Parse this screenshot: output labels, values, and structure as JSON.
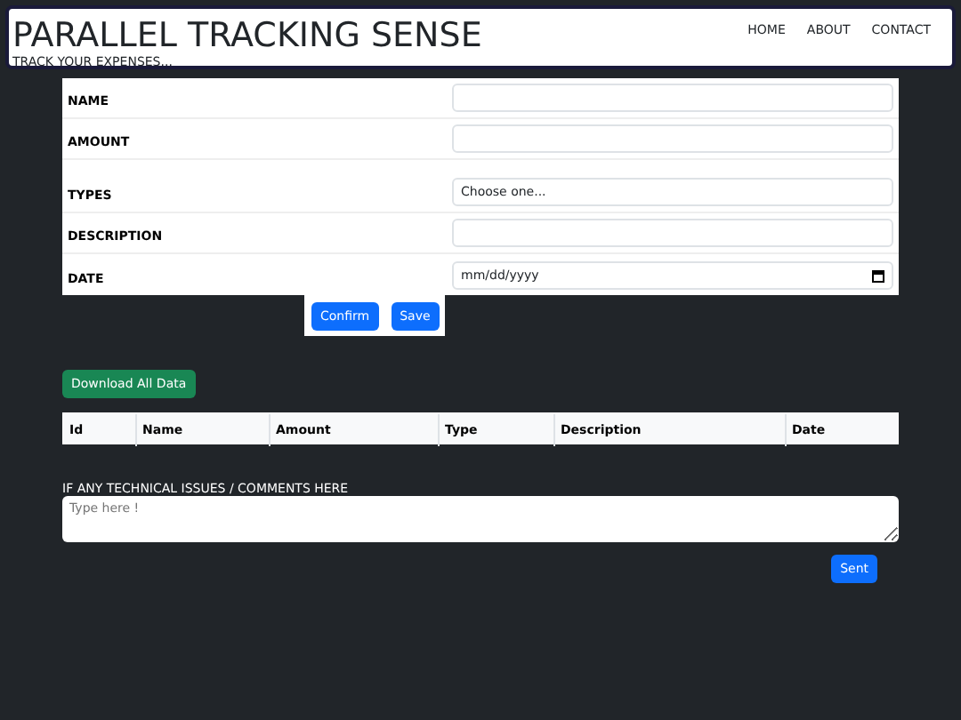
{
  "header": {
    "title": "PARALLEL TRACKING SENSE",
    "subtitle": "TRACK YOUR EXPENSES...",
    "nav": [
      "HOME",
      "ABOUT",
      "CONTACT"
    ]
  },
  "form": {
    "fields": [
      {
        "label": "NAME",
        "kind": "text"
      },
      {
        "label": "AMOUNT",
        "kind": "text"
      },
      {
        "label": "TYPES",
        "kind": "select",
        "value": "Choose one..."
      },
      {
        "label": "DESCRIPTION",
        "kind": "text"
      },
      {
        "label": "DATE",
        "kind": "date",
        "placeholder": "mm/dd/yyyy"
      }
    ],
    "buttons": [
      "Confirm",
      "Save"
    ]
  },
  "download_button": "Download All Data",
  "table": {
    "columns": [
      "Id",
      "Name",
      "Amount",
      "Type",
      "Description",
      "Date"
    ]
  },
  "comments": {
    "label": "IF ANY TECHNICAL ISSUES / COMMENTS HERE",
    "placeholder": "Type here !",
    "button": "Sent"
  }
}
